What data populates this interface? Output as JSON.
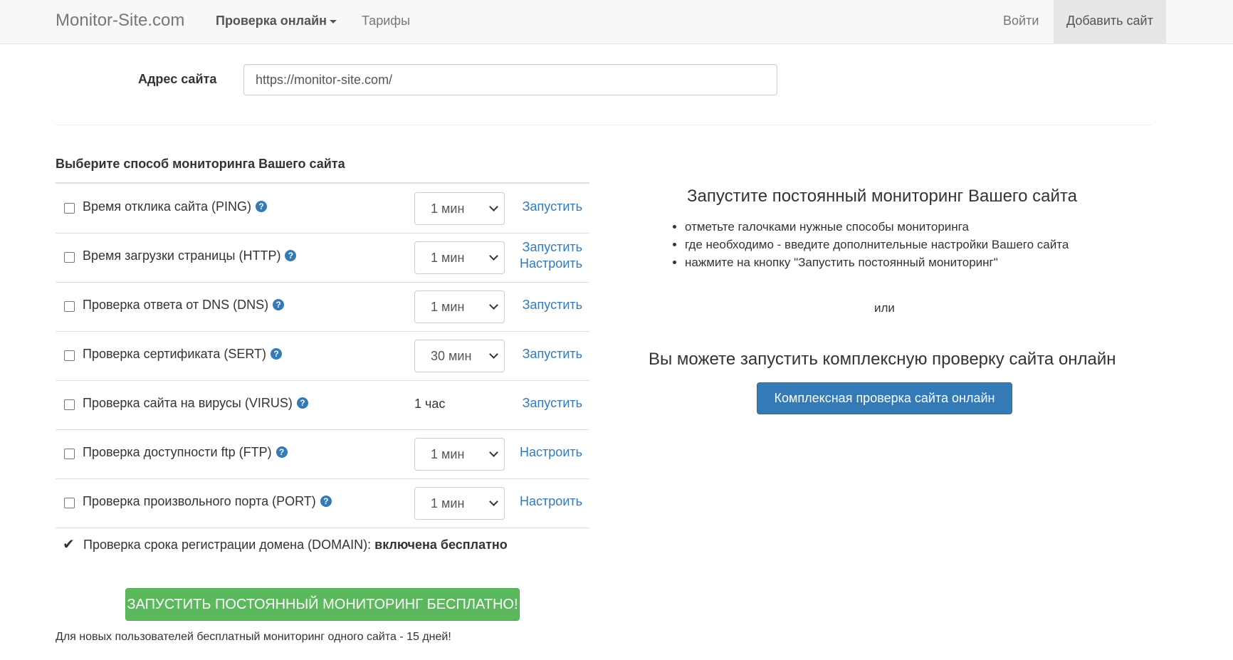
{
  "nav": {
    "brand": "Monitor-Site.com",
    "check_online": "Проверка онлайн",
    "tariffs": "Тарифы",
    "login": "Войти",
    "add_site": "Добавить сайт"
  },
  "address": {
    "label": "Адрес сайта",
    "value": "https://monitor-site.com/"
  },
  "monitoring": {
    "title": "Выберите способ мониторинга Вашего сайта",
    "rows": [
      {
        "label": "Время отклика сайта (PING)",
        "interval": "1 мин",
        "actions": [
          "Запустить"
        ]
      },
      {
        "label": "Время загрузки страницы (HTTP)",
        "interval": "1 мин",
        "actions": [
          "Запустить",
          "Настроить"
        ]
      },
      {
        "label": "Проверка ответа от DNS (DNS)",
        "interval": "1 мин",
        "actions": [
          "Запустить"
        ]
      },
      {
        "label": "Проверка сертификата (SERT)",
        "interval": "30 мин",
        "actions": [
          "Запустить"
        ]
      },
      {
        "label": "Проверка сайта на вирусы (VIRUS)",
        "interval": "1 час",
        "actions": [
          "Запустить"
        ]
      },
      {
        "label": "Проверка доступности ftp (FTP)",
        "interval": "1 мин",
        "actions": [
          "Настроить"
        ]
      },
      {
        "label": "Проверка произвольного порта (PORT)",
        "interval": "1 мин",
        "actions": [
          "Настроить"
        ]
      }
    ],
    "help_glyph": "?",
    "domain_label": "Проверка срока регистрации домена (DOMAIN):",
    "domain_status": "включена бесплатно",
    "start_button": "ЗАПУСТИТЬ ПОСТОЯННЫЙ МОНИТОРИНГ БЕСПЛАТНО!",
    "footnote": "Для новых пользователей бесплатный мониторинг одного сайта - 15 дней!"
  },
  "info": {
    "title": "Запустите постоянный мониторинг Вашего сайта",
    "bullets": [
      "отметьте галочками нужные способы мониторинга",
      "где необходимо - введите дополнительные настройки Вашего сайта",
      "нажмите на кнопку \"Запустить постоянный мониторинг\""
    ],
    "or": "или",
    "subtitle": "Вы можете запустить комплексную проверку сайта онлайн",
    "complex_button": "Комплексная проверка сайта онлайн"
  },
  "colors": {
    "link": "#337ab7",
    "success": "#5cb85c",
    "primary": "#337ab7",
    "navbar_bg": "#f8f8f8"
  }
}
